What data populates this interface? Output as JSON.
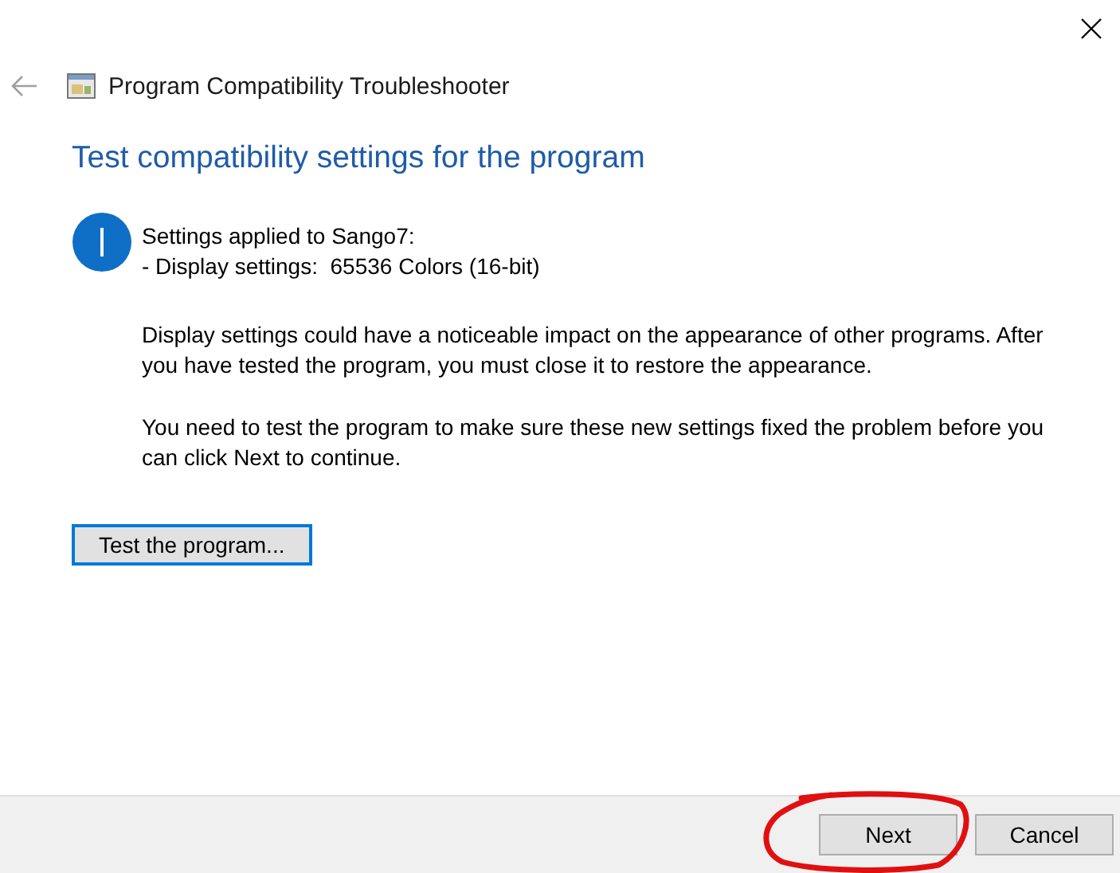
{
  "window": {
    "title": "Program Compatibility Troubleshooter"
  },
  "heading": "Test compatibility settings for the program",
  "info": {
    "lines": [
      "Settings applied to Sango7:",
      "- Display settings:  65536 Colors (16-bit)"
    ]
  },
  "paragraphs": [
    "Display settings could have a noticeable impact on the appearance of other programs. After you have tested the program, you must close it to restore the appearance.",
    "You need to test the program to make sure these new settings fixed the problem before you can click Next to continue."
  ],
  "test_button": {
    "label": "Test the program..."
  },
  "buttons": [
    {
      "label": "Next",
      "circled": true
    },
    {
      "label": "Cancel",
      "circled": false
    }
  ]
}
